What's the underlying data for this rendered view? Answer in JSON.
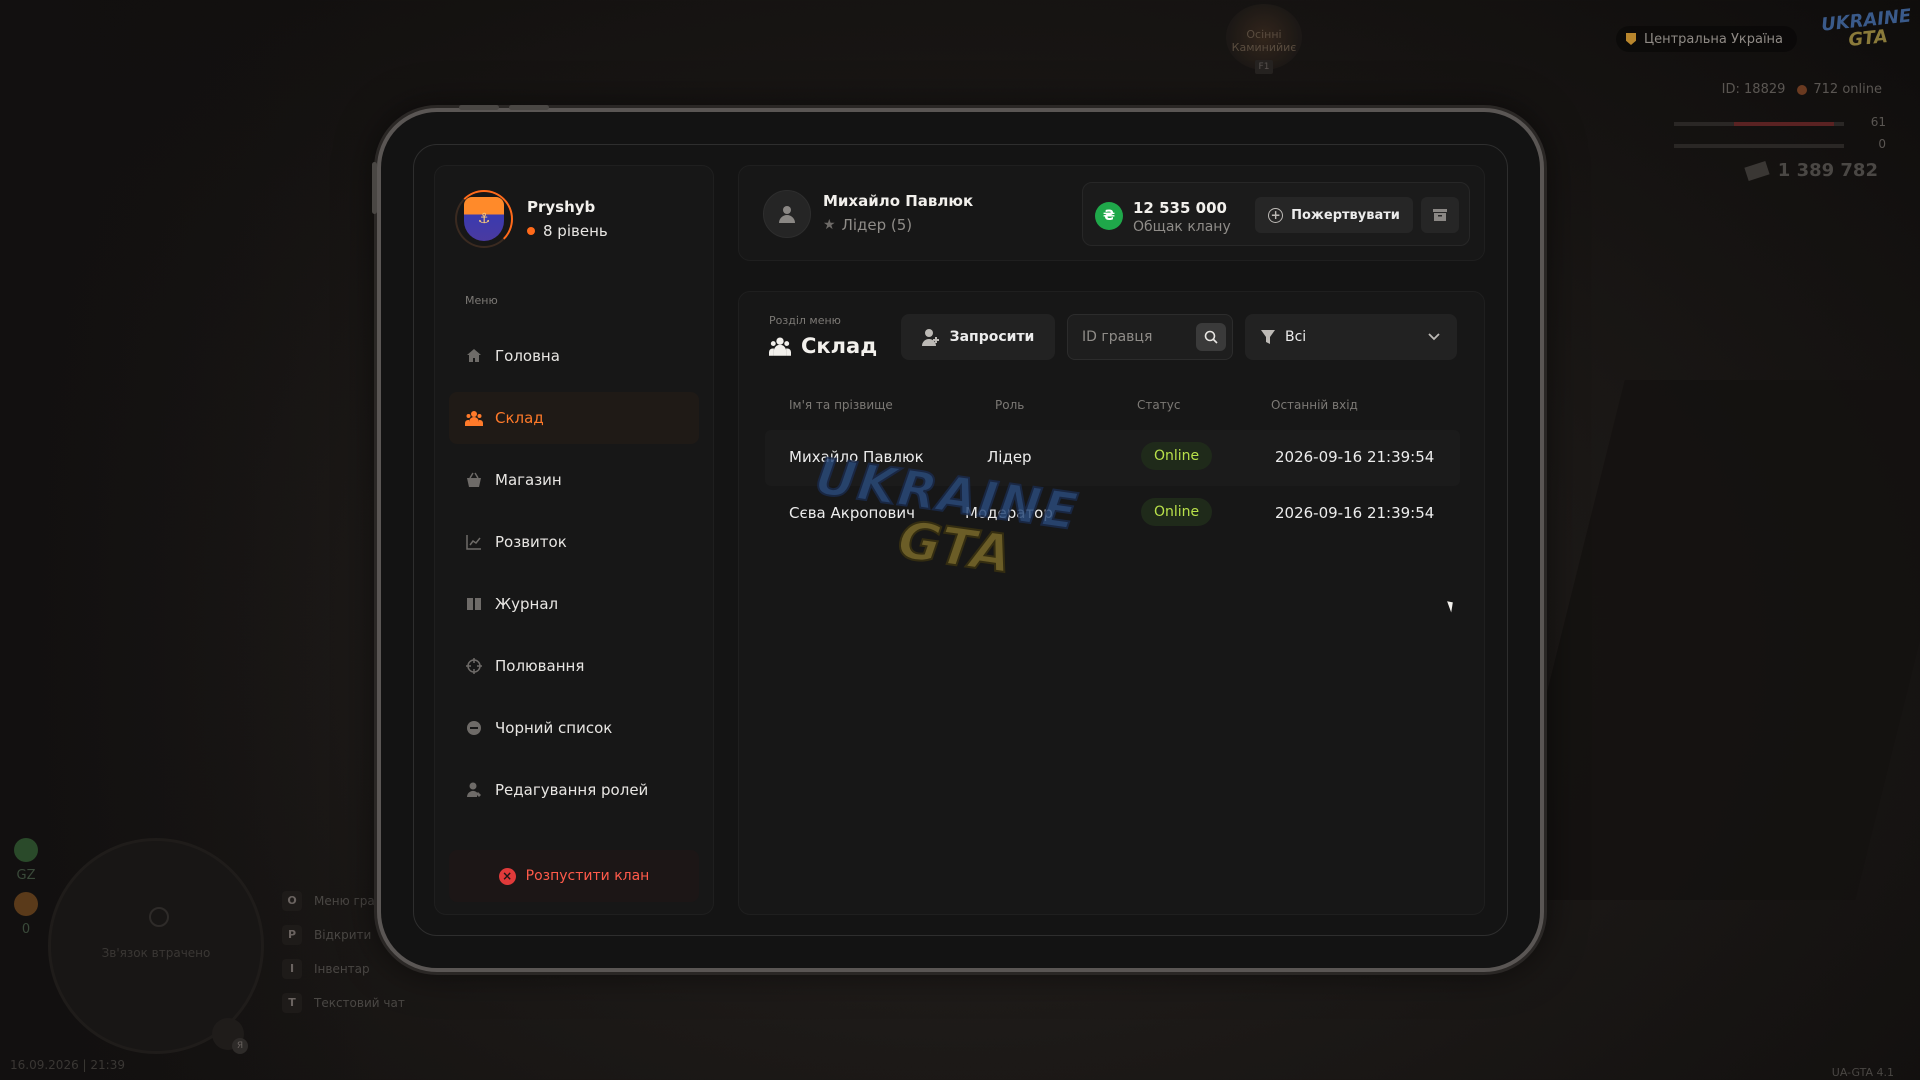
{
  "hud": {
    "region": "Центральна Україна",
    "logo_line1": "UKRAINE",
    "logo_line2": "GTA",
    "player_id": "ID: 18829",
    "online": "712 online",
    "health": "61",
    "armor": "0",
    "money": "1 389 782",
    "emblem_text": "Осінні Каминийиє",
    "emblem_key": "F1",
    "minimap_status": "Зв'язок втрачено",
    "zone_label": "GZ",
    "zone_value": "0",
    "voice_badge": "Я",
    "keyhints": [
      {
        "key": "O",
        "label": "Меню гра"
      },
      {
        "key": "P",
        "label": "Відкрити"
      },
      {
        "key": "I",
        "label": "Інвентар"
      },
      {
        "key": "T",
        "label": "Текстовий чат"
      }
    ],
    "datetime": "16.09.2026 | 21:39",
    "version": "UA-GTA 4.1"
  },
  "sidebar": {
    "profile_name": "Pryshyb",
    "profile_level": "8 рівень",
    "menu_title": "Меню",
    "items": [
      {
        "label": "Головна",
        "icon": "home-icon",
        "active": false
      },
      {
        "label": "Склад",
        "icon": "members-icon",
        "active": true
      },
      {
        "label": "Магазин",
        "icon": "shop-icon",
        "active": false
      },
      {
        "label": "Розвиток",
        "icon": "chart-icon",
        "active": false
      },
      {
        "label": "Журнал",
        "icon": "book-icon",
        "active": false
      },
      {
        "label": "Полювання",
        "icon": "crosshair-icon",
        "active": false
      },
      {
        "label": "Чорний список",
        "icon": "block-icon",
        "active": false
      },
      {
        "label": "Редагування ролей",
        "icon": "user-edit-icon",
        "active": false
      }
    ],
    "disband_label": "Розпустити клан"
  },
  "header": {
    "user_name": "Михайло Павлюк",
    "user_role": "Лідер (5)",
    "clan_money": "12 535 000",
    "clan_money_label": "Общак клану",
    "currency_symbol": "₴",
    "donate_label": "Пожертвувати"
  },
  "members": {
    "section_label": "Розділ меню",
    "section_title": "Склад",
    "invite_label": "Запросити",
    "search_placeholder": "ID гравця",
    "filter_value": "Всі",
    "columns": [
      "Ім'я та прізвище",
      "Роль",
      "Статус",
      "Останній вхід"
    ],
    "rows": [
      {
        "name": "Михайло Павлюк",
        "role": "Лідер",
        "status": "Online",
        "last_login": "2026-09-16 21:39:54"
      },
      {
        "name": "Сєва Акропович",
        "role": "Модератор",
        "status": "Online",
        "last_login": "2026-09-16 21:39:54"
      }
    ],
    "watermark_line1": "UKRAINE",
    "watermark_line2": "GTA"
  },
  "colors": {
    "accent": "#ff7a2a",
    "online": "#b8e04a",
    "money_icon": "#1fa84a",
    "danger": "#e03a3a"
  }
}
